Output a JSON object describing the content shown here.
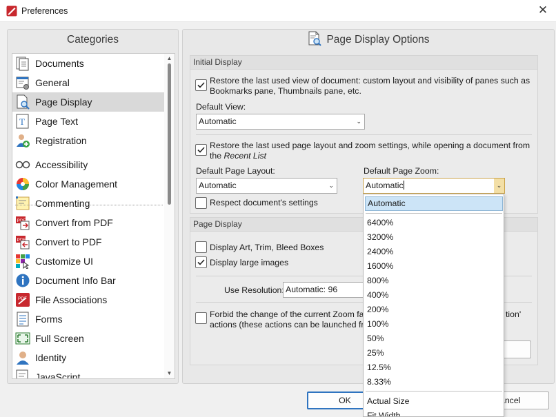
{
  "window": {
    "title": "Preferences"
  },
  "left_panel": {
    "header": "Categories",
    "items": [
      {
        "label": "Documents",
        "icon": "documents-icon"
      },
      {
        "label": "General",
        "icon": "general-icon"
      },
      {
        "label": "Page Display",
        "icon": "page-display-icon",
        "selected": true
      },
      {
        "label": "Page Text",
        "icon": "page-text-icon"
      },
      {
        "label": "Registration",
        "icon": "registration-icon"
      },
      {
        "label": "Accessibility",
        "icon": "accessibility-icon"
      },
      {
        "label": "Color Management",
        "icon": "color-management-icon"
      },
      {
        "label": "Commenting",
        "icon": "commenting-icon"
      },
      {
        "label": "Convert from PDF",
        "icon": "convert-from-pdf-icon"
      },
      {
        "label": "Convert to PDF",
        "icon": "convert-to-pdf-icon"
      },
      {
        "label": "Customize UI",
        "icon": "customize-ui-icon"
      },
      {
        "label": "Document Info Bar",
        "icon": "document-info-bar-icon"
      },
      {
        "label": "File Associations",
        "icon": "file-associations-icon"
      },
      {
        "label": "Forms",
        "icon": "forms-icon"
      },
      {
        "label": "Full Screen",
        "icon": "full-screen-icon"
      },
      {
        "label": "Identity",
        "icon": "identity-icon"
      },
      {
        "label": "JavaScript",
        "icon": "javascript-icon"
      }
    ]
  },
  "right_panel": {
    "header": "Page Display Options",
    "initial_display": {
      "title": "Initial Display",
      "restore_view_line1": "Restore the last used view of document: custom layout and visibility of panes such as",
      "restore_view_line2": "Bookmarks pane, Thumbnails pane, etc.",
      "restore_view_checked": true,
      "default_view_label": "Default View:",
      "default_view_value": "Automatic",
      "restore_layout_line1": "Restore the last used page layout and zoom settings, while opening a document from",
      "restore_layout_line2_prefix": "the",
      "restore_layout_line2_em": "Recent List",
      "restore_layout_checked": true,
      "default_layout_label": "Default Page Layout:",
      "default_layout_value": "Automatic",
      "default_zoom_label": "Default Page Zoom:",
      "default_zoom_value": "Automatic",
      "respect_label": "Respect document's settings",
      "respect_checked": false
    },
    "page_display": {
      "title": "Page Display",
      "art_trim_label": "Display Art, Trim, Bleed Boxes",
      "art_trim_checked": false,
      "large_images_label": "Display large images",
      "large_images_checked": true,
      "resolution_label": "Use Resolution:",
      "resolution_value": "Automatic: 96",
      "forbid_line1_a": "Forbid the change of the current Zoom fa",
      "forbid_line1_b": "tion'",
      "forbid_line2": "actions (these actions can be launched fro",
      "forbid_checked": false
    },
    "zoom_dropdown": {
      "selected": "Automatic",
      "options": [
        "6400%",
        "3200%",
        "2400%",
        "1600%",
        "800%",
        "400%",
        "200%",
        "100%",
        "50%",
        "25%",
        "12.5%",
        "8.33%"
      ],
      "fit_options": [
        "Actual Size",
        "Fit Width"
      ]
    }
  },
  "footer": {
    "ok_label": "OK",
    "cancel_label": "ancel"
  },
  "colors": {
    "accent": "#2f74c0",
    "selected_item": "#cce4f7",
    "app_icon_red": "#c8282e"
  }
}
